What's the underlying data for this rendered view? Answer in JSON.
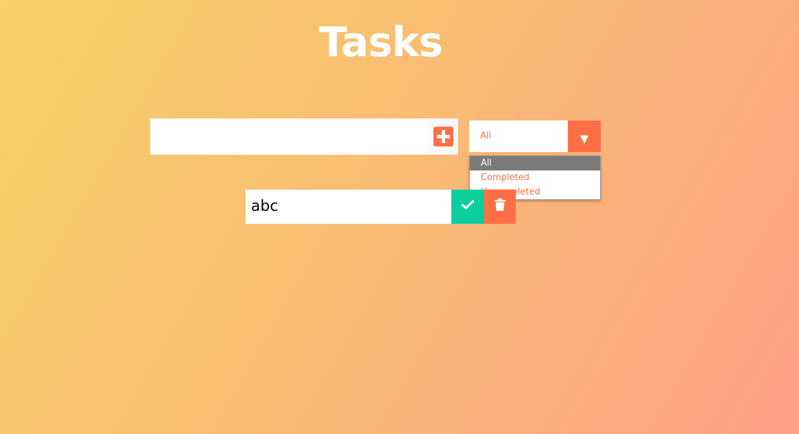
{
  "header": {
    "title": "Tasks"
  },
  "form": {
    "input_value": "",
    "input_placeholder": "",
    "add_icon": "plus-square-icon"
  },
  "filter": {
    "selected": "All",
    "arrow": "▼",
    "options": [
      "All",
      "Completed",
      "Uncompleted"
    ],
    "highlighted_option": "All"
  },
  "todos": [
    {
      "text": "abc",
      "complete_icon": "check-icon",
      "delete_icon": "trash-icon"
    }
  ],
  "colors": {
    "gradient_start": "#f6d365",
    "gradient_end": "#fda085",
    "accent": "#ff6f47",
    "complete": "#0bd09e",
    "option_highlight": "#7a7a7a"
  }
}
